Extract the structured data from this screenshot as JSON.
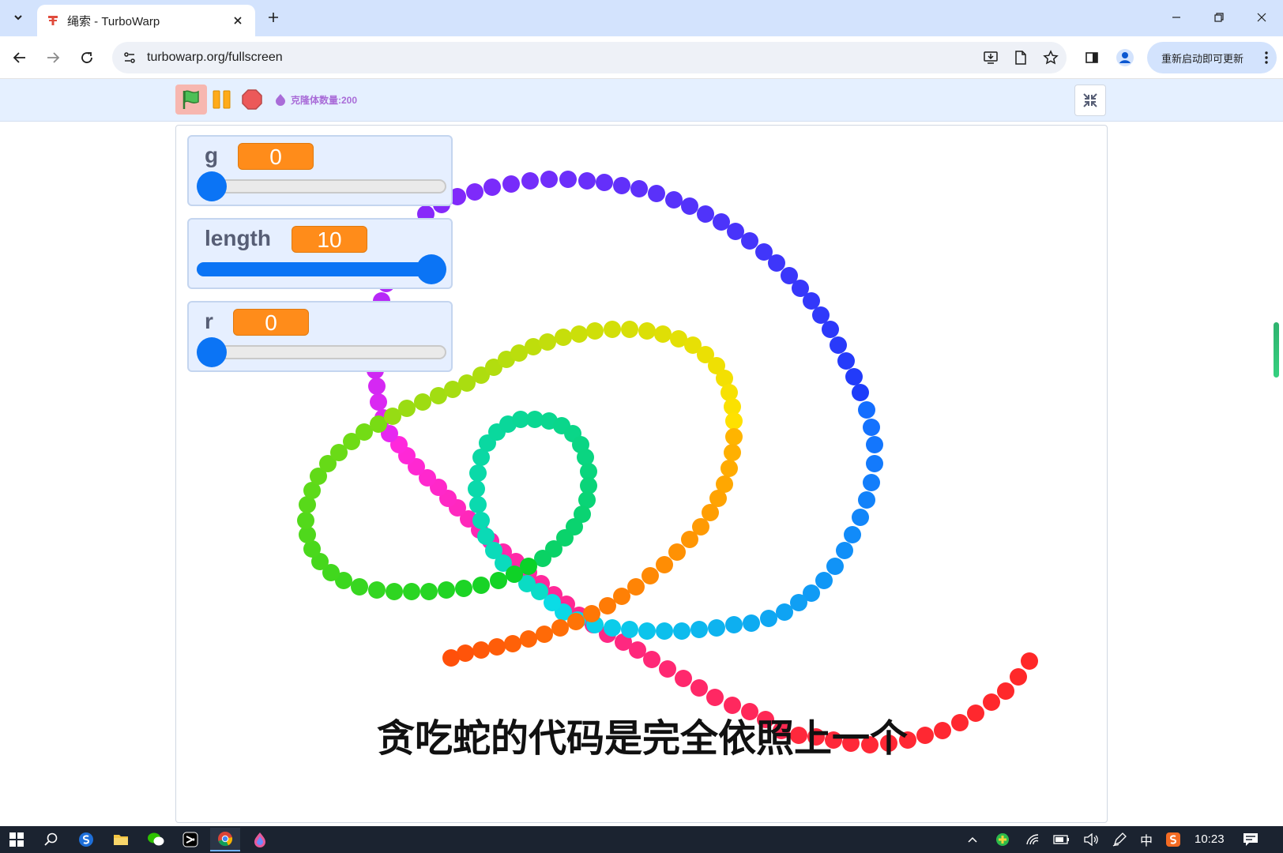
{
  "browser": {
    "tab_title": "绳索 - TurboWarp",
    "url": "turbowarp.org/fullscreen",
    "update_label": "重新启动即可更新"
  },
  "turbowarp": {
    "clone_count_label": "克隆体数量:200",
    "accent_color": "#0b74f5",
    "monitor_value_color": "#ff8c1a"
  },
  "monitors": [
    {
      "name": "g",
      "value": "0",
      "fraction": 0.0
    },
    {
      "name": "length",
      "value": "10",
      "fraction": 1.0
    },
    {
      "name": "r",
      "value": "0",
      "fraction": 0.0
    }
  ],
  "stage": {
    "subtitle": "贪吃蛇的代码是完全依照上一个"
  },
  "taskbar": {
    "ime_label": "中",
    "clock": "10:23"
  },
  "icons": {
    "tab_search": "chevron-down-icon",
    "favicon": "turbowarp-icon",
    "flag": "green-flag-icon",
    "pause": "pause-icon",
    "stop": "stop-icon",
    "fullscreen": "exit-fullscreen-icon"
  }
}
